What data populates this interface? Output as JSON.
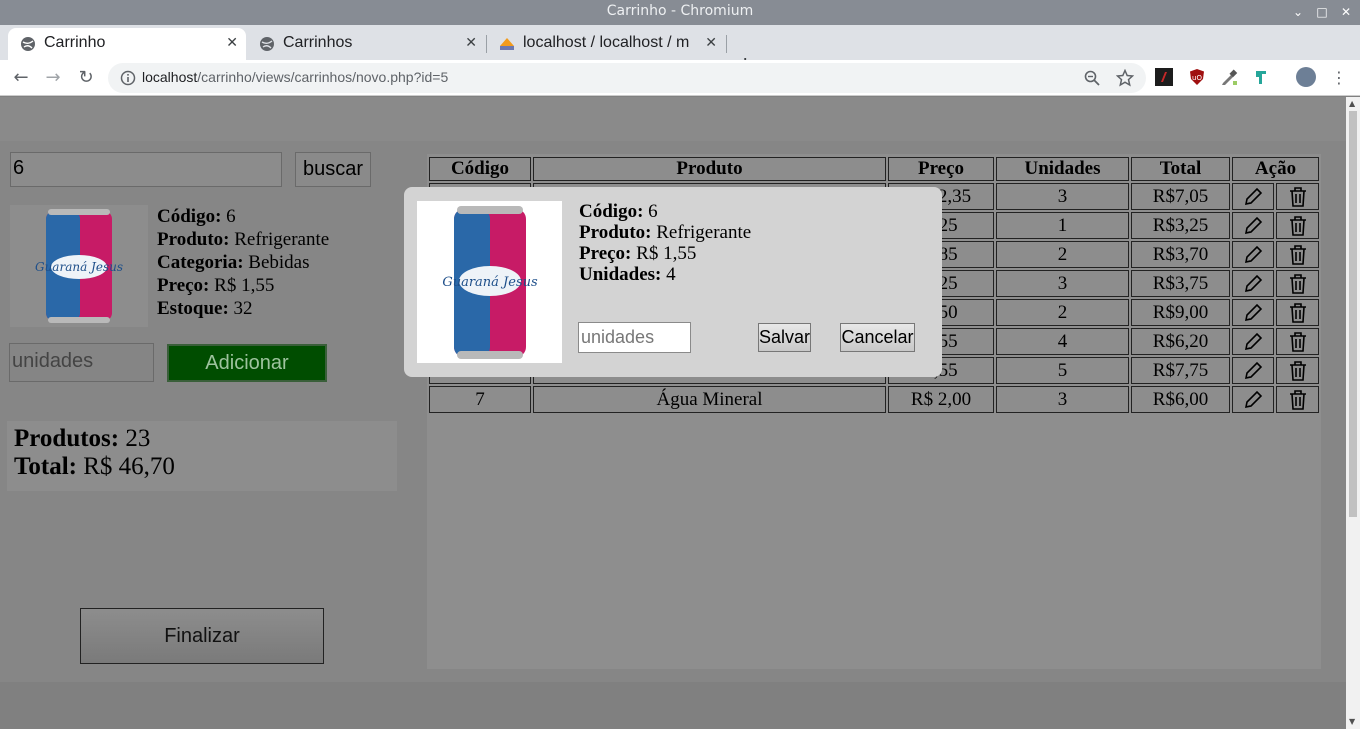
{
  "window": {
    "title": "Carrinho - Chromium"
  },
  "tabs": [
    {
      "label": "Carrinho",
      "active": true
    },
    {
      "label": "Carrinhos",
      "active": false
    },
    {
      "label": "localhost / localhost / m",
      "active": false
    }
  ],
  "address": {
    "host": "localhost",
    "path": "/carrinho/views/carrinhos/novo.php?id=5"
  },
  "search": {
    "value": "6",
    "button": "buscar"
  },
  "product": {
    "code_label": "Código:",
    "code": "6",
    "name_label": "Produto:",
    "name": "Refrigerante",
    "category_label": "Categoria:",
    "category": "Bebidas",
    "price_label": "Preço:",
    "price": "R$ 1,55",
    "stock_label": "Estoque:",
    "stock": "32",
    "brand_text": "Guaraná Jesus"
  },
  "add": {
    "placeholder": "unidades",
    "button": "Adicionar"
  },
  "summary": {
    "products_label": "Produtos:",
    "products": "23",
    "total_label": "Total:",
    "total": "R$ 46,70"
  },
  "finalize_button": "Finalizar",
  "cart": {
    "headers": [
      "Código",
      "Produto",
      "Preço",
      "Unidades",
      "Total",
      "Ação"
    ],
    "rows": [
      {
        "code": "",
        "product": "",
        "price": "R$ 2,35",
        "units": "3",
        "total": "R$7,05"
      },
      {
        "code": "",
        "product": "",
        "price": "3,25",
        "units": "1",
        "total": "R$3,25"
      },
      {
        "code": "",
        "product": "",
        "price": "1,85",
        "units": "2",
        "total": "R$3,70"
      },
      {
        "code": "",
        "product": "",
        "price": "1,25",
        "units": "3",
        "total": "R$3,75"
      },
      {
        "code": "",
        "product": "",
        "price": "4,50",
        "units": "2",
        "total": "R$9,00"
      },
      {
        "code": "",
        "product": "",
        "price": "1,55",
        "units": "4",
        "total": "R$6,20"
      },
      {
        "code": "",
        "product": "",
        "price": "1,55",
        "units": "5",
        "total": "R$7,75"
      },
      {
        "code": "7",
        "product": "Água Mineral",
        "price": "R$ 2,00",
        "units": "3",
        "total": "R$6,00"
      }
    ]
  },
  "modal": {
    "code_label": "Código:",
    "code": "6",
    "name_label": "Produto:",
    "name": "Refrigerante",
    "price_label": "Preço:",
    "price": "R$ 1,55",
    "units_label": "Unidades:",
    "units": "4",
    "qty_placeholder": "unidades",
    "save_button": "Salvar",
    "cancel_button": "Cancelar"
  },
  "colors": {
    "add_button": "#004d00",
    "modal_bg": "#d3d3d3",
    "page_bg": "#808080"
  }
}
